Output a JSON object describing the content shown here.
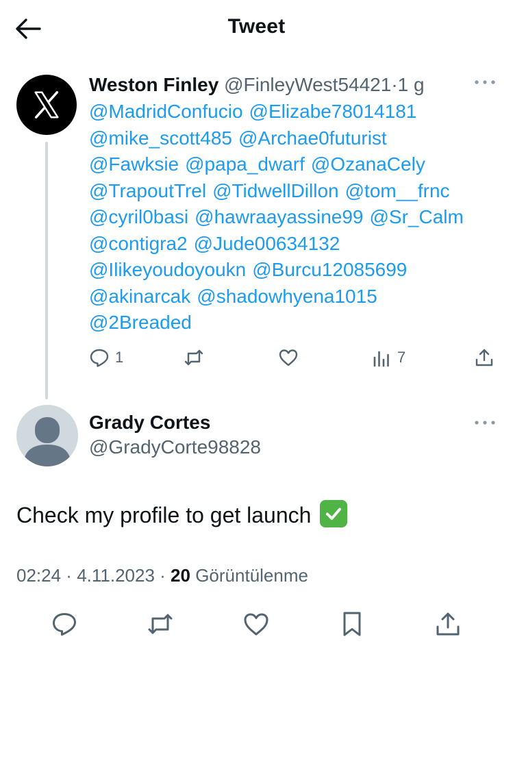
{
  "header": {
    "title": "Tweet"
  },
  "parent_tweet": {
    "name": "Weston Finley",
    "handle": "@FinleyWest54421",
    "separator": "·",
    "time": "1 g",
    "mentions": [
      "@MadridConfucio",
      "@Elizabe78014181",
      "@mike_scott485",
      "@Archae0futurist",
      "@Fawksie",
      "@papa_dwarf",
      "@OzanaCely",
      "@TrapoutTrel",
      "@TidwellDillon",
      "@tom__frnc",
      "@cyril0basi",
      "@hawraayassine99",
      "@Sr_Calm",
      "@contigra2",
      "@Jude00634132",
      "@Ilikeyoudoyoukn",
      "@Burcu12085699",
      "@akinarcak",
      "@shadowhyena1015",
      "@2Breaded"
    ],
    "reply_count": "1",
    "views_count": "7"
  },
  "main_tweet": {
    "name": "Grady Cortes",
    "handle": "@GradyCorte98828",
    "text": "Check my profile to get launch",
    "time": "02:24",
    "date": "4.11.2023",
    "views": "20",
    "views_label": "Görüntülenme"
  },
  "icons": {
    "back": "arrow-left-icon",
    "more": "more-horizontal-icon",
    "reply": "reply-icon",
    "retweet": "retweet-icon",
    "like": "heart-icon",
    "analytics": "analytics-icon",
    "share": "share-icon",
    "bookmark": "bookmark-icon"
  },
  "colors": {
    "link": "#1d9bf0",
    "secondary_text": "#536471",
    "primary_text": "#0f1419",
    "thread_line": "#cfd9de",
    "check_green": "#4fb346"
  }
}
